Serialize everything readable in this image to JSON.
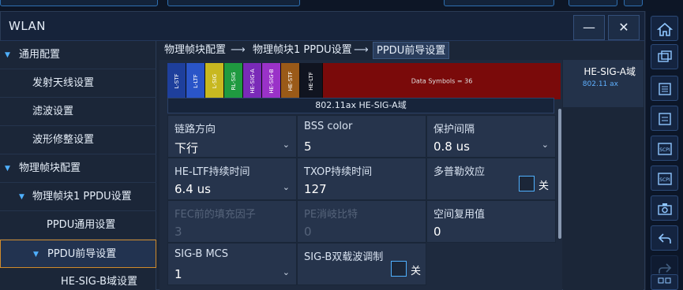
{
  "window": {
    "title": "WLAN",
    "minimize_icon": "minimize-icon",
    "close_icon": "close-icon",
    "minimize_glyph": "—",
    "close_glyph": "✕"
  },
  "tree": [
    {
      "label": "通用配置",
      "expanded": true
    },
    {
      "label": "发射天线设置"
    },
    {
      "label": "滤波设置"
    },
    {
      "label": "波形修整设置"
    },
    {
      "label": "物理帧块配置",
      "expanded": true
    },
    {
      "label": "物理帧块1 PPDU设置",
      "expanded": true
    },
    {
      "label": "PPDU通用设置"
    },
    {
      "label": "PPDU前导设置",
      "expanded": true,
      "selected": true
    },
    {
      "label": "HE-SIG-B域设置"
    }
  ],
  "breadcrumb": {
    "items": [
      "物理帧块配置",
      "物理帧块1 PPDU设置",
      "PPDU前导设置"
    ],
    "separator": "⟶"
  },
  "frame": {
    "segments": [
      {
        "label": "L-STF",
        "color": "#1e3f9c"
      },
      {
        "label": "L-LTF",
        "color": "#2a55c8"
      },
      {
        "label": "L-SIG",
        "color": "#c8b820"
      },
      {
        "label": "RL-SIG",
        "color": "#1f9a40"
      },
      {
        "label": "HE-SIG-A",
        "color": "#7a2ab8"
      },
      {
        "label": "HE-SIG-B",
        "color": "#9a32c8"
      },
      {
        "label": "HE-STF",
        "color": "#9a5a18"
      },
      {
        "label": "HE-LTF",
        "color": "#101420"
      },
      {
        "label": "Data Symbols = 36",
        "color": "#7a0a0a"
      }
    ],
    "caption": "802.11ax HE-SIG-A域"
  },
  "fields": {
    "link_direction": {
      "label": "链路方向",
      "value": "下行"
    },
    "bss_color": {
      "label": "BSS color",
      "value": "5"
    },
    "guard_interval": {
      "label": "保护间隔",
      "value": "0.8 us"
    },
    "he_ltf_duration": {
      "label": "HE-LTF持续时间",
      "value": "6.4 us"
    },
    "txop_duration": {
      "label": "TXOP持续时间",
      "value": "127"
    },
    "doppler": {
      "label": "多普勒效应",
      "value": "关"
    },
    "fec_padding": {
      "label": "FEC前的填充因子",
      "value": "3"
    },
    "pe_disambiguity": {
      "label": "PE消岐比特",
      "value": "0"
    },
    "spatial_reuse": {
      "label": "空间复用值",
      "value": "0"
    },
    "sig_b_mcs": {
      "label": "SIG-B MCS",
      "value": "1"
    },
    "sig_b_dcm": {
      "label": "SIG-B双载波调制",
      "value": "关"
    }
  },
  "info_panel": {
    "title": "HE-SIG-A域",
    "subtitle": "802.11 ax"
  },
  "toolbar": [
    "home-icon",
    "window-stack-icon",
    "memory-icon",
    "panel-icon",
    "scpi-icon",
    "scpi-icon-2",
    "camera-icon",
    "undo-icon",
    "redo-icon",
    "grid-icon"
  ],
  "toolbar_labels": {
    "scpi_1": "SCPI",
    "scpi_2": "SCPI"
  },
  "colors": {
    "accent": "#4fb0ff",
    "selection_border": "#d08a2a",
    "panel": "#26344c",
    "background": "#1b2638"
  }
}
